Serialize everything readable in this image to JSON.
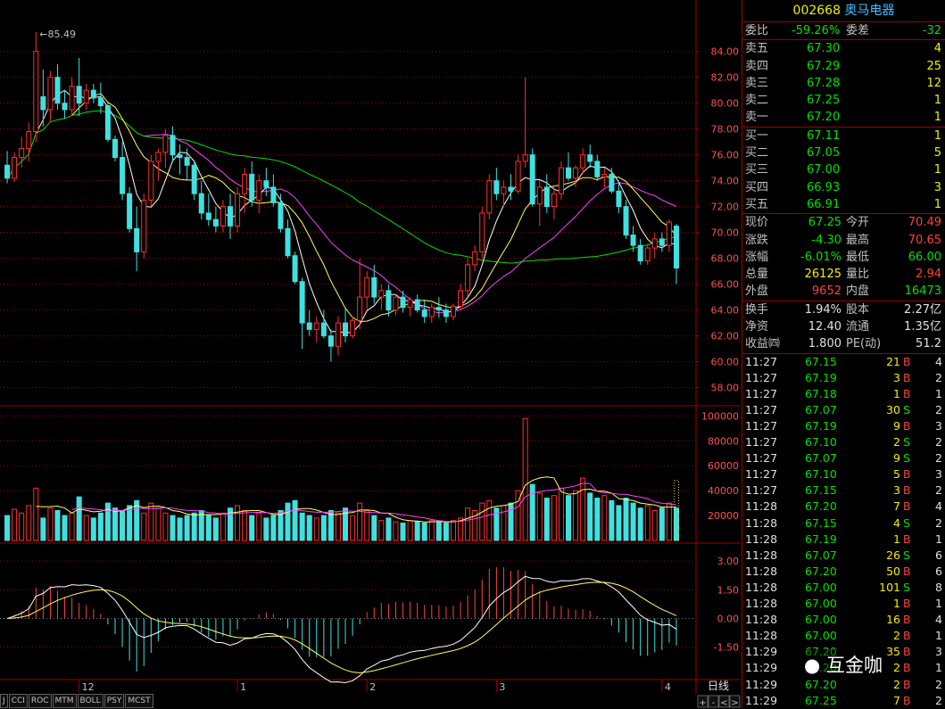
{
  "header": {
    "code": "002668",
    "name": "奥马电器"
  },
  "quote": {
    "wb_label": "委比",
    "wb_value": "-59.26%",
    "wc_label": "委差",
    "wc_value": "-32",
    "asks": [
      {
        "label": "卖五",
        "price": "67.30",
        "vol": "4"
      },
      {
        "label": "卖四",
        "price": "67.29",
        "vol": "25"
      },
      {
        "label": "卖三",
        "price": "67.28",
        "vol": "12"
      },
      {
        "label": "卖二",
        "price": "67.25",
        "vol": "1"
      },
      {
        "label": "卖一",
        "price": "67.20",
        "vol": "1"
      }
    ],
    "bids": [
      {
        "label": "买一",
        "price": "67.11",
        "vol": "1"
      },
      {
        "label": "买二",
        "price": "67.05",
        "vol": "5"
      },
      {
        "label": "买三",
        "price": "67.00",
        "vol": "1"
      },
      {
        "label": "买四",
        "price": "66.93",
        "vol": "3"
      },
      {
        "label": "买五",
        "price": "66.91",
        "vol": "1"
      }
    ],
    "stats": [
      {
        "l1": "现价",
        "v1": "67.25",
        "c1": "green",
        "l2": "今开",
        "v2": "70.49",
        "c2": "red"
      },
      {
        "l1": "涨跌",
        "v1": "-4.30",
        "c1": "green",
        "l2": "最高",
        "v2": "70.65",
        "c2": "red"
      },
      {
        "l1": "涨幅",
        "v1": "-6.01%",
        "c1": "green",
        "l2": "最低",
        "v2": "66.00",
        "c2": "green"
      },
      {
        "l1": "总量",
        "v1": "26125",
        "c1": "yellow",
        "l2": "量比",
        "v2": "2.94",
        "c2": "red"
      },
      {
        "l1": "外盘",
        "v1": "9652",
        "c1": "red",
        "l2": "内盘",
        "v2": "16473",
        "c2": "green"
      }
    ],
    "stats2": [
      {
        "l1": "换手",
        "v1": "1.94%",
        "l2": "股本",
        "v2": "2.27亿"
      },
      {
        "l1": "净资",
        "v1": "12.40",
        "l2": "流通",
        "v2": "1.35亿"
      },
      {
        "l1": "收益㈣",
        "v1": "1.800",
        "l2": "PE(动)",
        "v2": "51.2"
      }
    ]
  },
  "ticks": [
    {
      "t": "11:27",
      "p": "67.15",
      "v": "21",
      "s": "B",
      "n": "4"
    },
    {
      "t": "11:27",
      "p": "67.19",
      "v": "3",
      "s": "B",
      "n": "2"
    },
    {
      "t": "11:27",
      "p": "67.18",
      "v": "1",
      "s": "B",
      "n": "1"
    },
    {
      "t": "11:27",
      "p": "67.07",
      "v": "30",
      "s": "S",
      "n": "2"
    },
    {
      "t": "11:27",
      "p": "67.19",
      "v": "9",
      "s": "B",
      "n": "3"
    },
    {
      "t": "11:27",
      "p": "67.10",
      "v": "2",
      "s": "S",
      "n": "2"
    },
    {
      "t": "11:27",
      "p": "67.07",
      "v": "9",
      "s": "S",
      "n": "2"
    },
    {
      "t": "11:27",
      "p": "67.10",
      "v": "5",
      "s": "B",
      "n": "3"
    },
    {
      "t": "11:27",
      "p": "67.15",
      "v": "3",
      "s": "B",
      "n": "2"
    },
    {
      "t": "11:28",
      "p": "67.20",
      "v": "7",
      "s": "B",
      "n": "4"
    },
    {
      "t": "11:28",
      "p": "67.15",
      "v": "4",
      "s": "S",
      "n": "2"
    },
    {
      "t": "11:28",
      "p": "67.19",
      "v": "1",
      "s": "B",
      "n": "1"
    },
    {
      "t": "11:28",
      "p": "67.07",
      "v": "26",
      "s": "S",
      "n": "6"
    },
    {
      "t": "11:28",
      "p": "67.20",
      "v": "50",
      "s": "B",
      "n": "6"
    },
    {
      "t": "11:28",
      "p": "67.00",
      "v": "101",
      "s": "S",
      "n": "8"
    },
    {
      "t": "11:28",
      "p": "67.00",
      "v": "1",
      "s": "B",
      "n": "1"
    },
    {
      "t": "11:28",
      "p": "67.00",
      "v": "16",
      "s": "B",
      "n": "4"
    },
    {
      "t": "11:28",
      "p": "67.00",
      "v": "2",
      "s": "B",
      "n": "1"
    },
    {
      "t": "11:29",
      "p": "67.20",
      "v": "35",
      "s": "B",
      "n": "3"
    },
    {
      "t": "11:29",
      "p": "67.20",
      "v": "2",
      "s": "B",
      "n": "1"
    },
    {
      "t": "11:29",
      "p": "67.20",
      "v": "2",
      "s": "B",
      "n": "2"
    },
    {
      "t": "11:29",
      "p": "67.25",
      "v": "7",
      "s": "B",
      "n": "2"
    }
  ],
  "tabs": [
    "J",
    "CCI",
    "ROC",
    "MTM",
    "BOLL",
    "PSY",
    "MCST"
  ],
  "period_label": "日线",
  "nav_buttons": [
    "+",
    "-",
    "<",
    ">"
  ],
  "watermark": "互金咖",
  "chart_data": [
    {
      "type": "candlestick",
      "annotation_high": "85.49",
      "price_ticks": [
        "84.00",
        "82.00",
        "80.00",
        "78.00",
        "76.00",
        "74.00",
        "72.00",
        "70.00",
        "68.00",
        "66.00",
        "64.00",
        "62.00",
        "60.00",
        "58.00"
      ],
      "ylim": [
        56.8,
        86.6
      ],
      "x_labels": [
        {
          "label": "12",
          "index": 10
        },
        {
          "label": "1",
          "index": 32
        },
        {
          "label": "2",
          "index": 50
        },
        {
          "label": "3",
          "index": 68
        },
        {
          "label": "4",
          "index": 91
        }
      ],
      "ohlc": [
        [
          75.2,
          76.3,
          73.8,
          74.2
        ],
        [
          74.2,
          76.2,
          73.9,
          75.8
        ],
        [
          75.8,
          77.4,
          75.0,
          76.5
        ],
        [
          76.5,
          78.5,
          75.5,
          77.8
        ],
        [
          77.8,
          85.49,
          77.0,
          84.0
        ],
        [
          80.5,
          82.6,
          78.2,
          79.5
        ],
        [
          79.5,
          82.5,
          78.5,
          82.0
        ],
        [
          82.0,
          83.0,
          79.5,
          80.0
        ],
        [
          80.0,
          81.0,
          78.8,
          79.5
        ],
        [
          79.5,
          82.0,
          79.0,
          81.3
        ],
        [
          81.3,
          83.5,
          79.0,
          80.0
        ],
        [
          80.0,
          81.5,
          79.5,
          81.0
        ],
        [
          81.0,
          81.5,
          80.0,
          80.4
        ],
        [
          80.4,
          81.6,
          79.2,
          79.8
        ],
        [
          79.8,
          80.0,
          77.0,
          77.2
        ],
        [
          77.2,
          77.5,
          75.5,
          75.8
        ],
        [
          75.8,
          77.0,
          72.5,
          73.0
        ],
        [
          73.0,
          73.5,
          70.0,
          70.3
        ],
        [
          70.3,
          72.0,
          67.0,
          68.5
        ],
        [
          68.5,
          73.0,
          68.0,
          72.5
        ],
        [
          72.5,
          76.0,
          72.0,
          75.5
        ],
        [
          75.5,
          76.5,
          74.0,
          76.2
        ],
        [
          76.2,
          78.0,
          75.0,
          77.5
        ],
        [
          77.5,
          78.2,
          75.5,
          76.0
        ],
        [
          76.0,
          76.8,
          74.5,
          75.8
        ],
        [
          75.8,
          76.5,
          74.0,
          75.2
        ],
        [
          75.2,
          75.6,
          72.5,
          73.0
        ],
        [
          73.0,
          74.0,
          71.0,
          71.5
        ],
        [
          71.5,
          73.0,
          70.5,
          71.0
        ],
        [
          71.0,
          72.0,
          70.0,
          70.5
        ],
        [
          70.5,
          72.5,
          70.0,
          72.0
        ],
        [
          72.0,
          73.0,
          69.5,
          70.5
        ],
        [
          70.5,
          73.5,
          70.0,
          73.0
        ],
        [
          73.0,
          75.0,
          71.5,
          74.5
        ],
        [
          74.5,
          75.5,
          72.0,
          72.5
        ],
        [
          72.5,
          74.5,
          71.5,
          74.0
        ],
        [
          74.0,
          75.0,
          72.8,
          73.5
        ],
        [
          73.5,
          74.5,
          72.0,
          72.3
        ],
        [
          72.3,
          73.0,
          70.0,
          70.3
        ],
        [
          70.3,
          71.0,
          68.0,
          68.2
        ],
        [
          68.2,
          68.5,
          66.0,
          66.2
        ],
        [
          66.2,
          66.5,
          61.0,
          63.0
        ],
        [
          63.0,
          64.0,
          62.0,
          62.5
        ],
        [
          62.5,
          63.5,
          61.5,
          63.0
        ],
        [
          63.0,
          64.0,
          61.8,
          62.0
        ],
        [
          62.0,
          62.5,
          60.0,
          61.2
        ],
        [
          61.2,
          63.5,
          60.5,
          63.0
        ],
        [
          63.0,
          64.2,
          61.5,
          62.0
        ],
        [
          62.0,
          63.5,
          61.8,
          63.2
        ],
        [
          63.2,
          68.0,
          62.5,
          65.0
        ],
        [
          65.0,
          67.0,
          64.0,
          66.5
        ],
        [
          66.5,
          67.5,
          64.5,
          65.0
        ],
        [
          65.0,
          66.0,
          64.0,
          65.5
        ],
        [
          65.5,
          66.0,
          63.5,
          64.0
        ],
        [
          64.0,
          65.2,
          63.6,
          65.0
        ],
        [
          65.0,
          65.5,
          63.8,
          64.2
        ],
        [
          64.2,
          65.0,
          63.5,
          64.8
        ],
        [
          64.8,
          65.2,
          63.8,
          64.0
        ],
        [
          64.0,
          64.8,
          63.0,
          63.5
        ],
        [
          63.5,
          64.5,
          63.0,
          64.2
        ],
        [
          64.2,
          65.0,
          63.4,
          64.0
        ],
        [
          64.0,
          64.5,
          63.0,
          63.5
        ],
        [
          63.5,
          64.5,
          63.2,
          64.3
        ],
        [
          64.3,
          66.0,
          64.0,
          65.5
        ],
        [
          65.5,
          68.0,
          65.0,
          67.5
        ],
        [
          67.5,
          69.0,
          67.0,
          68.5
        ],
        [
          68.5,
          72.0,
          68.0,
          71.5
        ],
        [
          71.5,
          74.5,
          71.0,
          74.0
        ],
        [
          74.0,
          75.0,
          72.5,
          73.0
        ],
        [
          73.0,
          74.0,
          72.0,
          73.5
        ],
        [
          73.5,
          74.5,
          72.5,
          73.2
        ],
        [
          73.2,
          76.0,
          73.0,
          75.5
        ],
        [
          75.5,
          82.0,
          75.0,
          76.0
        ],
        [
          76.0,
          76.5,
          72.0,
          72.2
        ],
        [
          72.2,
          74.0,
          70.5,
          73.5
        ],
        [
          73.5,
          74.5,
          71.5,
          72.0
        ],
        [
          72.0,
          73.5,
          71.0,
          73.0
        ],
        [
          73.0,
          75.5,
          72.5,
          75.0
        ],
        [
          75.0,
          76.2,
          74.0,
          74.2
        ],
        [
          74.2,
          75.2,
          73.5,
          75.0
        ],
        [
          75.0,
          76.5,
          74.5,
          76.0
        ],
        [
          76.0,
          76.8,
          75.0,
          75.5
        ],
        [
          75.5,
          76.0,
          74.0,
          74.3
        ],
        [
          74.3,
          75.0,
          73.5,
          74.5
        ],
        [
          74.5,
          75.0,
          73.0,
          73.2
        ],
        [
          73.2,
          74.0,
          71.5,
          72.0
        ],
        [
          72.0,
          72.5,
          69.5,
          69.8
        ],
        [
          69.8,
          70.5,
          68.5,
          69.0
        ],
        [
          69.0,
          69.5,
          67.5,
          67.8
        ],
        [
          67.8,
          69.0,
          67.5,
          68.8
        ],
        [
          68.8,
          70.0,
          68.0,
          69.5
        ],
        [
          69.5,
          70.0,
          68.5,
          69.0
        ],
        [
          69.0,
          71.0,
          68.5,
          70.8
        ],
        [
          70.49,
          70.65,
          66.0,
          67.25
        ]
      ],
      "ma_colors": {
        "ma5": "#ffffff",
        "ma10": "#ffff60",
        "ma20": "#ff40ff",
        "ma60": "#00e000"
      }
    },
    {
      "type": "bar",
      "volume_ticks": [
        "100000",
        "80000",
        "60000",
        "40000",
        "20000"
      ],
      "ylim": [
        0,
        106000
      ],
      "volumes": [
        20000,
        25000,
        22000,
        28000,
        42000,
        18000,
        26000,
        24000,
        20000,
        22000,
        35000,
        20000,
        18000,
        22000,
        30000,
        26000,
        24000,
        28000,
        32000,
        22000,
        30000,
        26000,
        22000,
        20000,
        18000,
        20000,
        22000,
        24000,
        20000,
        18000,
        22000,
        26000,
        28000,
        24000,
        20000,
        22000,
        18000,
        20000,
        24000,
        30000,
        32000,
        22000,
        20000,
        18000,
        20000,
        24000,
        22000,
        26000,
        20000,
        30000,
        24000,
        20000,
        16000,
        18000,
        15000,
        14000,
        16000,
        15000,
        14000,
        16000,
        15000,
        14000,
        16000,
        18000,
        26000,
        24000,
        30000,
        32000,
        26000,
        28000,
        30000,
        40000,
        98000,
        45000,
        38000,
        34000,
        36000,
        42000,
        36000,
        40000,
        50000,
        38000,
        34000,
        36000,
        32000,
        28000,
        34000,
        30000,
        26000,
        28000,
        24000,
        26000,
        30000,
        26000
      ],
      "ma_colors": {
        "ma5": "#ffff60",
        "ma10": "#ff40ff"
      }
    },
    {
      "type": "macd",
      "macd_ticks": [
        "3.00",
        "1.50",
        "0.00",
        "-1.50"
      ],
      "ylim": [
        -3.1,
        3.8
      ],
      "colors": {
        "dif": "#ffffff",
        "dea": "#ffff60",
        "pos": "#ff4040",
        "neg": "#40e0e0"
      }
    }
  ]
}
